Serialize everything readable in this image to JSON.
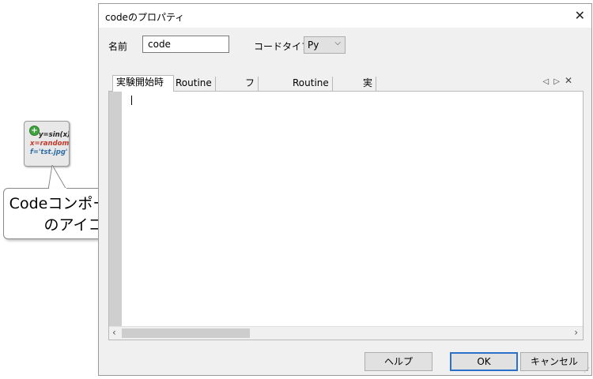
{
  "component_icon": {
    "line1": "y=sin(x)",
    "line2": "x=random(,",
    "line3": "f='tst.jpg'"
  },
  "callout": {
    "line1": "Codeコンポーネント",
    "line2": "のアイコン"
  },
  "dialog": {
    "title": "codeのプロパティ",
    "name_label": "名前",
    "name_value": "code",
    "code_type_label": "コードタイプ",
    "code_type_value": "Py",
    "tabs": [
      "実験開始時",
      "Routine開始時",
      "フレーム毎",
      "Routine終了時",
      "実験終了時"
    ],
    "active_tab": "実験開始時",
    "buttons": {
      "help": "ヘルプ",
      "ok": "OK",
      "cancel": "キャンセル"
    }
  }
}
